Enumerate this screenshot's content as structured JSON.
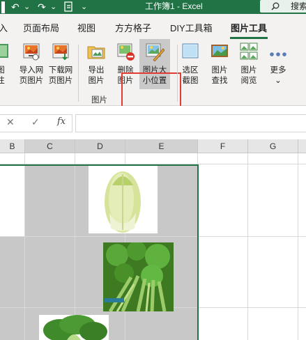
{
  "titlebar": {
    "title": "工作簿1  -  Excel",
    "search_label": "搜索",
    "undo_glyph": "↶",
    "redo_glyph": "↷",
    "dropdown_glyph": "⌄",
    "accent_color": "#217346"
  },
  "tabs": {
    "items": [
      "入",
      "页面布局",
      "视图",
      "方方格子",
      "DIY工具箱",
      "图片工具"
    ],
    "active": "图片工具"
  },
  "ribbon": {
    "buttons": [
      {
        "label": "图\n注"
      },
      {
        "label": "导入网\n页图片"
      },
      {
        "label": "下载网\n页图片"
      },
      {
        "label": "导出\n图片"
      },
      {
        "label": "删除\n图片"
      },
      {
        "label": "图片大\n小位置"
      },
      {
        "label": "选区\n截图"
      },
      {
        "label": "图片\n查找"
      },
      {
        "label": "图片\n阅览"
      },
      {
        "label": "更多\n⌄"
      }
    ],
    "group_label": "图片",
    "highlight_color": "#e03c31"
  },
  "formula_bar": {
    "cancel_glyph": "✕",
    "confirm_glyph": "✓",
    "fx_label": "fx",
    "value": ""
  },
  "sheet": {
    "columns": [
      "B",
      "C",
      "D",
      "E",
      "F",
      "G"
    ],
    "selection_color": "#217346"
  }
}
